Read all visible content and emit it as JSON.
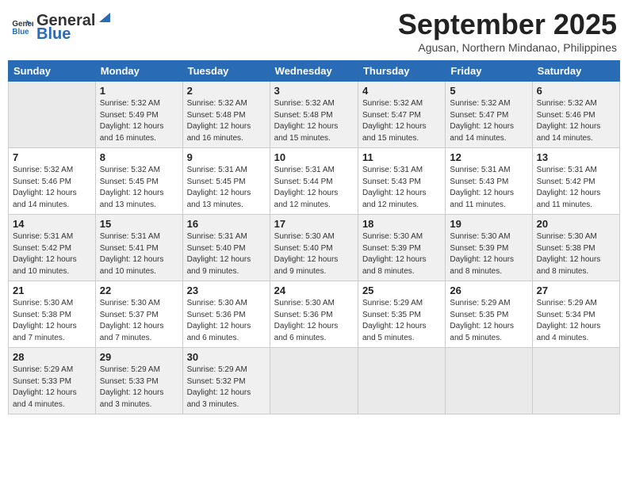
{
  "header": {
    "logo_general": "General",
    "logo_blue": "Blue",
    "month": "September 2025",
    "location": "Agusan, Northern Mindanao, Philippines"
  },
  "days_of_week": [
    "Sunday",
    "Monday",
    "Tuesday",
    "Wednesday",
    "Thursday",
    "Friday",
    "Saturday"
  ],
  "weeks": [
    [
      {
        "day": "",
        "info": ""
      },
      {
        "day": "1",
        "info": "Sunrise: 5:32 AM\nSunset: 5:49 PM\nDaylight: 12 hours\nand 16 minutes."
      },
      {
        "day": "2",
        "info": "Sunrise: 5:32 AM\nSunset: 5:48 PM\nDaylight: 12 hours\nand 16 minutes."
      },
      {
        "day": "3",
        "info": "Sunrise: 5:32 AM\nSunset: 5:48 PM\nDaylight: 12 hours\nand 15 minutes."
      },
      {
        "day": "4",
        "info": "Sunrise: 5:32 AM\nSunset: 5:47 PM\nDaylight: 12 hours\nand 15 minutes."
      },
      {
        "day": "5",
        "info": "Sunrise: 5:32 AM\nSunset: 5:47 PM\nDaylight: 12 hours\nand 14 minutes."
      },
      {
        "day": "6",
        "info": "Sunrise: 5:32 AM\nSunset: 5:46 PM\nDaylight: 12 hours\nand 14 minutes."
      }
    ],
    [
      {
        "day": "7",
        "info": "Sunrise: 5:32 AM\nSunset: 5:46 PM\nDaylight: 12 hours\nand 14 minutes."
      },
      {
        "day": "8",
        "info": "Sunrise: 5:32 AM\nSunset: 5:45 PM\nDaylight: 12 hours\nand 13 minutes."
      },
      {
        "day": "9",
        "info": "Sunrise: 5:31 AM\nSunset: 5:45 PM\nDaylight: 12 hours\nand 13 minutes."
      },
      {
        "day": "10",
        "info": "Sunrise: 5:31 AM\nSunset: 5:44 PM\nDaylight: 12 hours\nand 12 minutes."
      },
      {
        "day": "11",
        "info": "Sunrise: 5:31 AM\nSunset: 5:43 PM\nDaylight: 12 hours\nand 12 minutes."
      },
      {
        "day": "12",
        "info": "Sunrise: 5:31 AM\nSunset: 5:43 PM\nDaylight: 12 hours\nand 11 minutes."
      },
      {
        "day": "13",
        "info": "Sunrise: 5:31 AM\nSunset: 5:42 PM\nDaylight: 12 hours\nand 11 minutes."
      }
    ],
    [
      {
        "day": "14",
        "info": "Sunrise: 5:31 AM\nSunset: 5:42 PM\nDaylight: 12 hours\nand 10 minutes."
      },
      {
        "day": "15",
        "info": "Sunrise: 5:31 AM\nSunset: 5:41 PM\nDaylight: 12 hours\nand 10 minutes."
      },
      {
        "day": "16",
        "info": "Sunrise: 5:31 AM\nSunset: 5:40 PM\nDaylight: 12 hours\nand 9 minutes."
      },
      {
        "day": "17",
        "info": "Sunrise: 5:30 AM\nSunset: 5:40 PM\nDaylight: 12 hours\nand 9 minutes."
      },
      {
        "day": "18",
        "info": "Sunrise: 5:30 AM\nSunset: 5:39 PM\nDaylight: 12 hours\nand 8 minutes."
      },
      {
        "day": "19",
        "info": "Sunrise: 5:30 AM\nSunset: 5:39 PM\nDaylight: 12 hours\nand 8 minutes."
      },
      {
        "day": "20",
        "info": "Sunrise: 5:30 AM\nSunset: 5:38 PM\nDaylight: 12 hours\nand 8 minutes."
      }
    ],
    [
      {
        "day": "21",
        "info": "Sunrise: 5:30 AM\nSunset: 5:38 PM\nDaylight: 12 hours\nand 7 minutes."
      },
      {
        "day": "22",
        "info": "Sunrise: 5:30 AM\nSunset: 5:37 PM\nDaylight: 12 hours\nand 7 minutes."
      },
      {
        "day": "23",
        "info": "Sunrise: 5:30 AM\nSunset: 5:36 PM\nDaylight: 12 hours\nand 6 minutes."
      },
      {
        "day": "24",
        "info": "Sunrise: 5:30 AM\nSunset: 5:36 PM\nDaylight: 12 hours\nand 6 minutes."
      },
      {
        "day": "25",
        "info": "Sunrise: 5:29 AM\nSunset: 5:35 PM\nDaylight: 12 hours\nand 5 minutes."
      },
      {
        "day": "26",
        "info": "Sunrise: 5:29 AM\nSunset: 5:35 PM\nDaylight: 12 hours\nand 5 minutes."
      },
      {
        "day": "27",
        "info": "Sunrise: 5:29 AM\nSunset: 5:34 PM\nDaylight: 12 hours\nand 4 minutes."
      }
    ],
    [
      {
        "day": "28",
        "info": "Sunrise: 5:29 AM\nSunset: 5:33 PM\nDaylight: 12 hours\nand 4 minutes."
      },
      {
        "day": "29",
        "info": "Sunrise: 5:29 AM\nSunset: 5:33 PM\nDaylight: 12 hours\nand 3 minutes."
      },
      {
        "day": "30",
        "info": "Sunrise: 5:29 AM\nSunset: 5:32 PM\nDaylight: 12 hours\nand 3 minutes."
      },
      {
        "day": "",
        "info": ""
      },
      {
        "day": "",
        "info": ""
      },
      {
        "day": "",
        "info": ""
      },
      {
        "day": "",
        "info": ""
      }
    ]
  ]
}
